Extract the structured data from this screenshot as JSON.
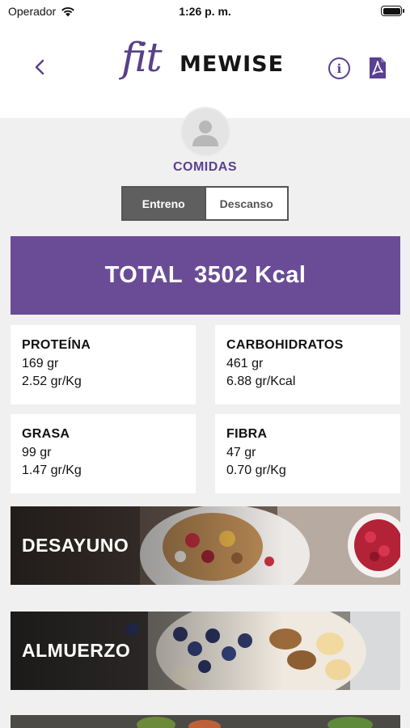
{
  "status_bar": {
    "carrier": "Operador",
    "time": "1:26 p. m."
  },
  "header": {
    "logo_script": "fit",
    "logo_word": "MEWISE",
    "icons": {
      "back": "chevron-left-icon",
      "info": "info-icon",
      "pdf": "pdf-icon",
      "avatar": "user-avatar-icon"
    }
  },
  "section_title": "COMIDAS",
  "toggle": {
    "options": [
      "Entreno",
      "Descanso"
    ],
    "selected": "Entreno"
  },
  "total": {
    "label": "TOTAL",
    "value": "3502 Kcal"
  },
  "macros": [
    {
      "name": "PROTEÍNA",
      "amount": "169 gr",
      "ratio": "2.52 gr/Kg"
    },
    {
      "name": "CARBOHIDRATOS",
      "amount": "461 gr",
      "ratio": "6.88 gr/Kcal"
    },
    {
      "name": "GRASA",
      "amount": "99 gr",
      "ratio": "1.47 gr/Kg"
    },
    {
      "name": "FIBRA",
      "amount": "47 gr",
      "ratio": "0.70 gr/Kg"
    }
  ],
  "meals": [
    "DESAYUNO",
    "ALMUERZO"
  ],
  "colors": {
    "brand": "#6a4c96",
    "accent": "#5b3f90",
    "toggle_active": "#5f5f5f"
  }
}
